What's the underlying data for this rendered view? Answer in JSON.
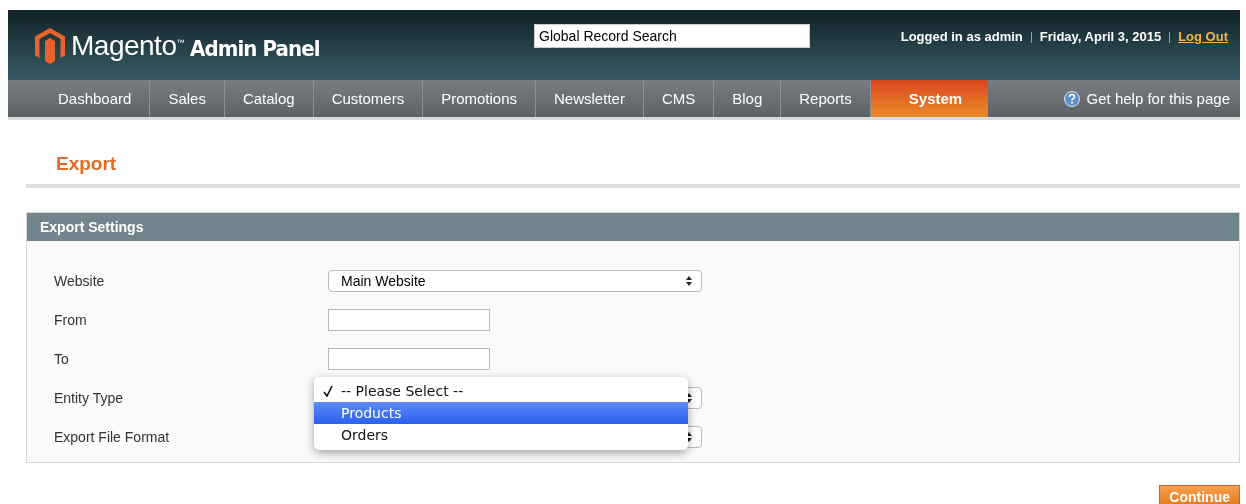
{
  "header": {
    "logo": "Magento$^{™}$",
    "product": "Admin Panel",
    "search": {
      "value": "Global Record Search"
    },
    "user": "Logged in as admin",
    "date": "Friday, April 3, 2015",
    "logout": "Log Out"
  },
  "nav": {
    "items": [
      {
        "label": "Dashboard",
        "selected": false
      },
      {
        "label": "Sales",
        "selected": false
      },
      {
        "label": "Catalog",
        "selected": false
      },
      {
        "label": "Customers",
        "selected": false
      },
      {
        "label": "Promotions",
        "selected": false
      },
      {
        "label": "Newsletter",
        "selected": false
      },
      {
        "label": "CMS",
        "selected": false
      },
      {
        "label": "Blog",
        "selected": false
      },
      {
        "label": "Reports",
        "selected": false
      },
      {
        "label": "System",
        "selected": true
      }
    ],
    "help": "Get help for this page"
  },
  "page": {
    "title": "Export"
  },
  "panel": {
    "title": "Export Settings",
    "fields": [
      {
        "label": "Website",
        "kind": "select",
        "value": "Main Website"
      },
      {
        "label": "From",
        "kind": "text"
      },
      {
        "label": "To",
        "kind": "text"
      },
      {
        "label": "Entity Type",
        "kind": "select",
        "expanded": true,
        "options": [
          {
            "label": "-- Please Select --",
            "checked": true,
            "highlighted": false
          },
          {
            "label": "Products",
            "checked": false,
            "highlighted": true
          },
          {
            "label": "Orders",
            "checked": false,
            "highlighted": false
          }
        ]
      },
      {
        "label": "Export File Format",
        "kind": "select"
      }
    ]
  },
  "buttons": [
    {
      "label": "Continue"
    }
  ]
}
